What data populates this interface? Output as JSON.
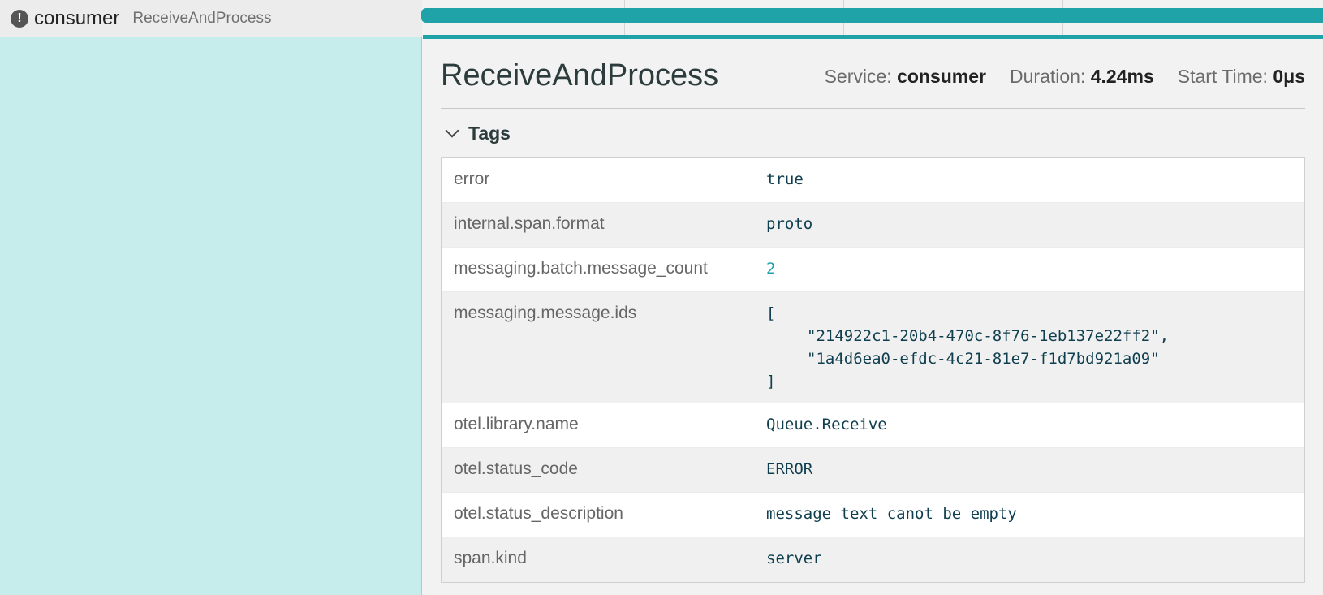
{
  "span": {
    "service": "consumer",
    "operation": "ReceiveAndProcess",
    "error_icon_glyph": "!"
  },
  "detail": {
    "title": "ReceiveAndProcess",
    "overview": {
      "service_label": "Service:",
      "service_value": "consumer",
      "duration_label": "Duration:",
      "duration_value": "4.24ms",
      "start_label": "Start Time:",
      "start_value": "0μs"
    }
  },
  "tags": {
    "label": "Tags",
    "rows": [
      {
        "key": "error",
        "value": "true"
      },
      {
        "key": "internal.span.format",
        "value": "proto"
      },
      {
        "key": "messaging.batch.message_count",
        "value": "2"
      },
      {
        "key": "messaging.message.ids",
        "lines": [
          "[",
          "\"214922c1-20b4-470c-8f76-1eb137e22ff2\",",
          "\"1a4d6ea0-efdc-4c21-81e7-f1d7bd921a09\"",
          "]"
        ]
      },
      {
        "key": "otel.library.name",
        "value": "Queue.Receive"
      },
      {
        "key": "otel.status_code",
        "value": "ERROR"
      },
      {
        "key": "otel.status_description",
        "value": "message text canot be empty"
      },
      {
        "key": "span.kind",
        "value": "server"
      }
    ]
  },
  "colors": {
    "span_bar": "#1fa3a8",
    "left_bg": "#c6ecec",
    "number_value": "#1fa3a8"
  }
}
